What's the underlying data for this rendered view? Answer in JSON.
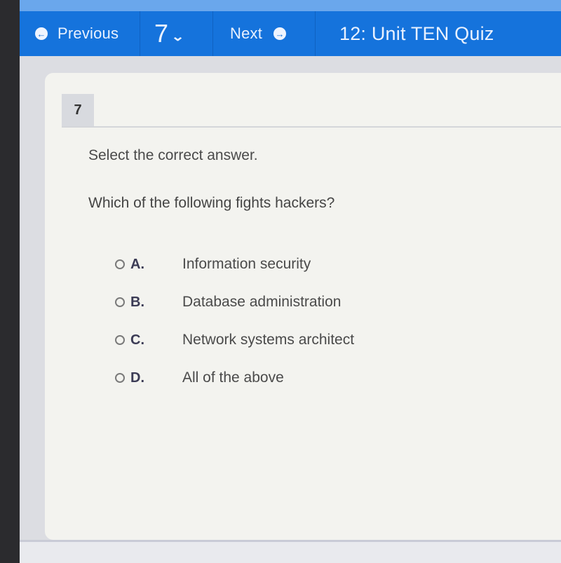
{
  "nav": {
    "previous_label": "Previous",
    "previous_icon": "arrow-left-circle-icon",
    "question_number": "7",
    "question_dropdown_icon": "chevron-down-icon",
    "next_label": "Next",
    "next_icon": "arrow-right-circle-icon",
    "quiz_title": "12: Unit TEN Quiz"
  },
  "question": {
    "number": "7",
    "instruction": "Select the correct answer.",
    "prompt": "Which of the following fights hackers?",
    "options": [
      {
        "letter": "A.",
        "text": "Information security",
        "selected": false
      },
      {
        "letter": "B.",
        "text": "Database administration",
        "selected": false
      },
      {
        "letter": "C.",
        "text": "Network systems architect",
        "selected": false
      },
      {
        "letter": "D.",
        "text": "All of the above",
        "selected": false
      }
    ]
  },
  "colors": {
    "nav_background": "#1573dc",
    "nav_text": "#e8f1ff",
    "card_background": "#f3f3ef"
  }
}
